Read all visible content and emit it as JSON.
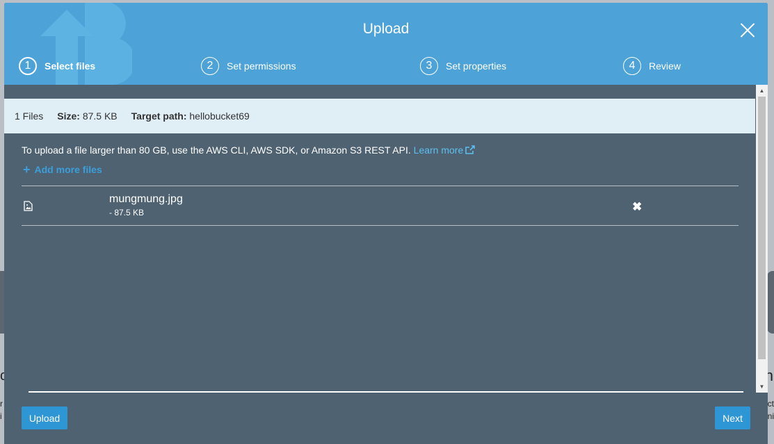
{
  "background": {
    "left_heading_fragment": "c",
    "left_text_fragment": "r\ni",
    "right_heading_fragment": "n",
    "right_text_fragment": "ct\nni"
  },
  "modal": {
    "title": "Upload",
    "steps": [
      {
        "number": "1",
        "label": "Select files",
        "active": true
      },
      {
        "number": "2",
        "label": "Set permissions",
        "active": false
      },
      {
        "number": "3",
        "label": "Set properties",
        "active": false
      },
      {
        "number": "4",
        "label": "Review",
        "active": false
      }
    ]
  },
  "summary": {
    "files_count": "1 Files",
    "size_label": "Size:",
    "size_value": "87.5 KB",
    "target_label": "Target path:",
    "target_value": "hellobucket69"
  },
  "info": {
    "text": "To upload a file larger than 80 GB, use the AWS CLI, AWS SDK, or Amazon S3 REST API.",
    "link": "Learn more"
  },
  "add_more_label": "Add more files",
  "files": [
    {
      "name": "mungmung.jpg",
      "size": "- 87.5 KB",
      "icon": "image-file-icon"
    }
  ],
  "buttons": {
    "upload": "Upload",
    "next": "Next"
  },
  "colors": {
    "header": "#4da3d8",
    "body": "#4f6271",
    "summary_bar": "#e0eef6",
    "link": "#5bc0f0",
    "button": "#2f96d6"
  }
}
